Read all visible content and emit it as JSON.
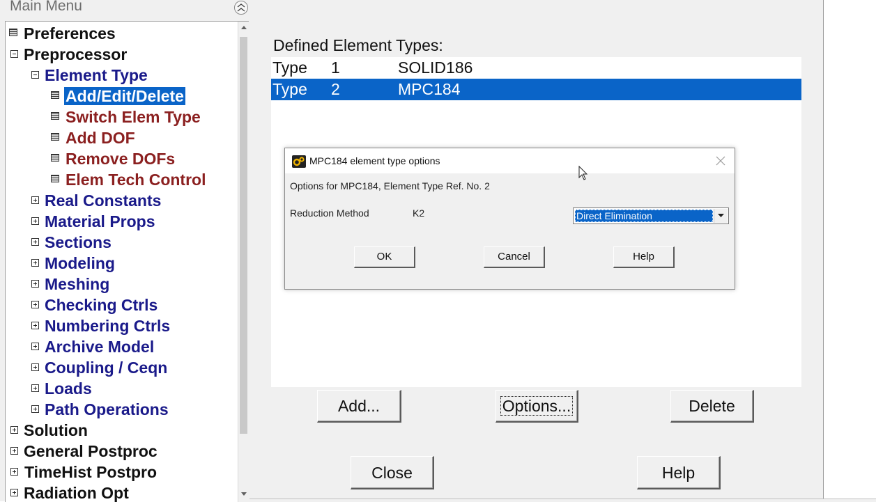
{
  "main_menu": {
    "title": "Main Menu",
    "items": [
      {
        "label": "Preferences",
        "icon": "calculator-icon"
      },
      {
        "label": "Preprocessor",
        "icon": "collapse-box-icon"
      },
      {
        "label": "Element Type",
        "icon": "collapse-box-icon"
      },
      {
        "label": "Add/Edit/Delete",
        "icon": "calculator-icon",
        "selected": true
      },
      {
        "label": "Switch Elem Type",
        "icon": "calculator-icon"
      },
      {
        "label": "Add DOF",
        "icon": "calculator-icon"
      },
      {
        "label": "Remove DOFs",
        "icon": "calculator-icon"
      },
      {
        "label": "Elem Tech Control",
        "icon": "calculator-icon"
      },
      {
        "label": "Real Constants",
        "icon": "expand-box-icon"
      },
      {
        "label": "Material Props",
        "icon": "expand-box-icon"
      },
      {
        "label": "Sections",
        "icon": "expand-box-icon"
      },
      {
        "label": "Modeling",
        "icon": "expand-box-icon"
      },
      {
        "label": "Meshing",
        "icon": "expand-box-icon"
      },
      {
        "label": "Checking Ctrls",
        "icon": "expand-box-icon"
      },
      {
        "label": "Numbering Ctrls",
        "icon": "expand-box-icon"
      },
      {
        "label": "Archive Model",
        "icon": "expand-box-icon"
      },
      {
        "label": "Coupling / Ceqn",
        "icon": "expand-box-icon"
      },
      {
        "label": "Loads",
        "icon": "expand-box-icon"
      },
      {
        "label": "Path Operations",
        "icon": "expand-box-icon"
      },
      {
        "label": "Solution",
        "icon": "expand-box-icon"
      },
      {
        "label": "General Postproc",
        "icon": "expand-box-icon"
      },
      {
        "label": "TimeHist Postpro",
        "icon": "expand-box-icon"
      },
      {
        "label": "Radiation Opt",
        "icon": "expand-box-icon"
      }
    ]
  },
  "element_types": {
    "heading": "Defined Element Types:",
    "rows": [
      {
        "type": "Type",
        "number": "1",
        "name": "SOLID186",
        "selected": false
      },
      {
        "type": "Type",
        "number": "2",
        "name": "MPC184",
        "selected": true
      }
    ],
    "buttons": {
      "add": "Add...",
      "options": "Options...",
      "delete": "Delete",
      "close": "Close",
      "help": "Help"
    }
  },
  "dialog": {
    "title": "MPC184 element type options",
    "subtitle": "Options for MPC184, Element Type Ref. No. 2",
    "field_label": "Reduction Method",
    "field_key": "K2",
    "field_value": "Direct Elimination",
    "buttons": {
      "ok": "OK",
      "cancel": "Cancel",
      "help": "Help"
    }
  },
  "colors": {
    "selection": "#0a64c8",
    "menu_blue": "#1a1a8a",
    "menu_maroon": "#8b2020"
  }
}
